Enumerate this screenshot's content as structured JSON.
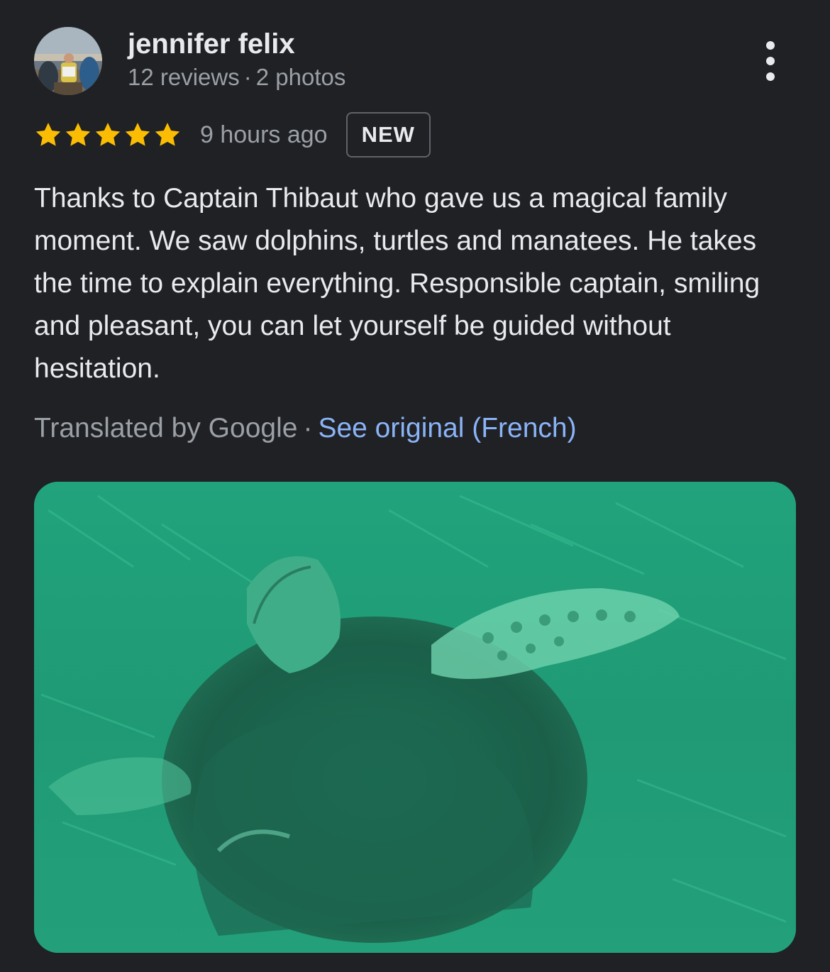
{
  "author": {
    "name": "jennifer felix",
    "reviews": "12 reviews",
    "photos": "2 photos",
    "separator": "·"
  },
  "rating": {
    "stars": 5,
    "max_stars": 5,
    "star_color": "#fbbc04",
    "time_ago": "9 hours ago",
    "badge": "NEW"
  },
  "review_text": "Thanks to Captain Thibaut who gave us a magical family moment. We saw dolphins, turtles and manatees. He takes the time to explain everything. Responsible captain, smiling and pleasant, you can let yourself be guided without hesitation.",
  "translation": {
    "label": "Translated by Google",
    "separator": "·",
    "link": "See original (French)",
    "link_color": "#8ab4f8"
  },
  "icons": {
    "menu": "more-vertical-icon",
    "star": "star-icon"
  }
}
